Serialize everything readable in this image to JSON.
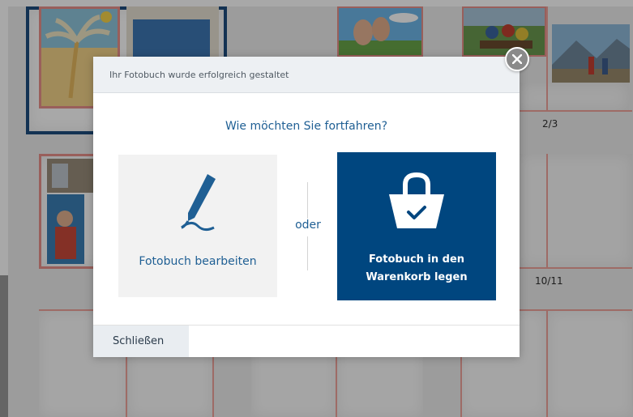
{
  "background": {
    "page_numbers": [
      "2/3",
      "10/11"
    ]
  },
  "dialog": {
    "header_title": "Ihr Fotobuch wurde erfolgreich gestaltet",
    "question": "Wie möchten Sie fortfahren?",
    "option_edit": {
      "label": "Fotobuch bearbeiten",
      "icon": "pen-icon"
    },
    "separator": "oder",
    "option_cart": {
      "line1": "Fotobuch in den",
      "line2": "Warenkorb legen",
      "icon": "shopping-bag-icon"
    },
    "close_label": "Schließen",
    "close_icon": "close-icon"
  },
  "colors": {
    "accent_blue": "#00467f",
    "link_blue": "#1f5f94",
    "page_guide_red": "#f0a39c"
  }
}
